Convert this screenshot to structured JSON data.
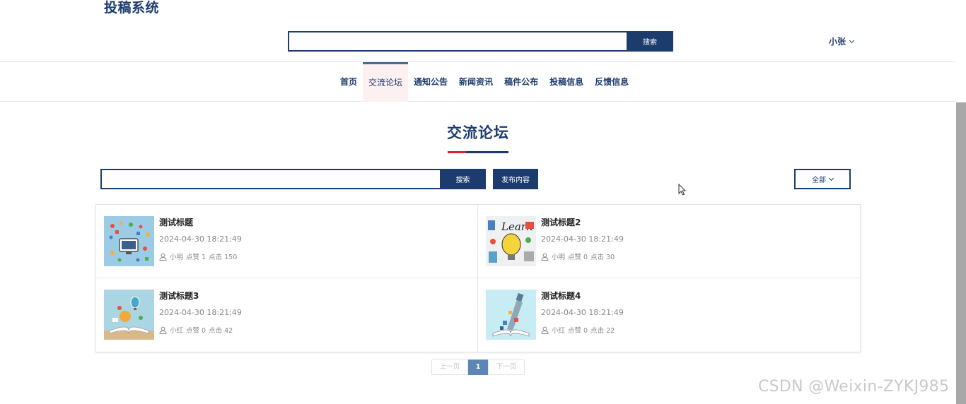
{
  "header": {
    "site_title": "投稿系统",
    "search_placeholder": "",
    "search_button": "搜索",
    "user_name": "小张"
  },
  "nav": {
    "items": [
      "首页",
      "交流论坛",
      "通知公告",
      "新闻资讯",
      "稿件公布",
      "投稿信息",
      "反馈信息"
    ],
    "active": "交流论坛"
  },
  "section": {
    "title": "交流论坛",
    "search_button": "搜索",
    "publish_button": "发布内容",
    "filter_label": "全部"
  },
  "posts": [
    {
      "title": "测试标题",
      "time": "2024-04-30 18:21:49",
      "author": "小明",
      "likes_label": "点赞 1",
      "clicks_label": "点击 150"
    },
    {
      "title": "测试标题2",
      "time": "2024-04-30 18:21:49",
      "author": "小明",
      "likes_label": "点赞 0",
      "clicks_label": "点击 30"
    },
    {
      "title": "测试标题3",
      "time": "2024-04-30 18:21:49",
      "author": "小红",
      "likes_label": "点赞 0",
      "clicks_label": "点击 42"
    },
    {
      "title": "测试标题4",
      "time": "2024-04-30 18:21:49",
      "author": "小红",
      "likes_label": "点赞 0",
      "clicks_label": "点击 22"
    }
  ],
  "pagination": {
    "prev": "上一页",
    "current": "1",
    "next": "下一页"
  },
  "watermark": "CSDN @Weixin-ZYKJ985",
  "colors": {
    "primary": "#1d3c6e",
    "accent_red": "#d9252c",
    "active_page": "#5d86b4"
  }
}
